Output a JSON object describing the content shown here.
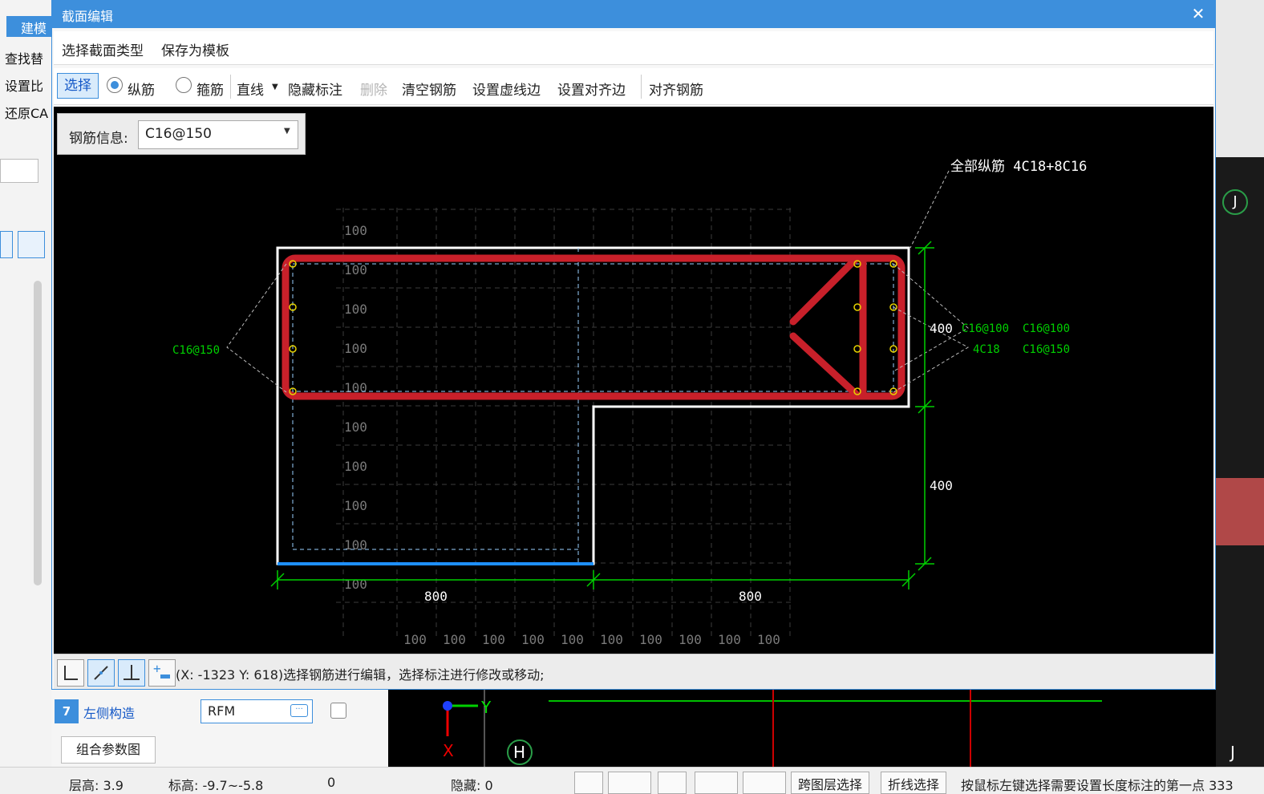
{
  "background_app": {
    "module_tab": "建模",
    "side_items": [
      "查找替",
      "设置比",
      "还原CA"
    ],
    "property_row": {
      "number": "7",
      "label": "左侧构造",
      "value": "RFM"
    },
    "combo_button": "组合参数图",
    "status": {
      "floor_height": "层高: 3.9",
      "elevation": "标高: -9.7~-5.8",
      "count": "0",
      "hidden": "隐藏: 0",
      "cross_layer_select": "跨图层选择",
      "polyline_select": "折线选择",
      "hint": "按鼠标左键选择需要设置长度标注的第一点 333"
    },
    "axis_labels": [
      "H",
      "J",
      "J",
      "Y",
      "X"
    ]
  },
  "dialog": {
    "title": "截面编辑",
    "close_label": "✕",
    "menu": [
      "选择截面类型",
      "保存为模板"
    ],
    "toolbar": {
      "select": "选择",
      "longitudinal": "纵筋",
      "stirrup": "箍筋",
      "line": "直线",
      "hide_dimension": "隐藏标注",
      "delete": "删除",
      "clear_rebar": "清空钢筋",
      "set_dashed_edge": "设置虚线边",
      "set_align_edge": "设置对齐边",
      "align_rebar": "对齐钢筋"
    },
    "rebar_info": {
      "label": "钢筋信息:",
      "value": "C16@150"
    },
    "drawing": {
      "all_longitudinal": "全部纵筋  4C18+8C16",
      "left_stirrup": "C16@150",
      "right_labels": [
        "400",
        "C16@100",
        "C16@100",
        "4C18",
        "C16@150"
      ],
      "dim_vertical": [
        "400",
        "400"
      ],
      "dim_horizontal": [
        "800",
        "800"
      ],
      "grid_label": "100",
      "colors": {
        "rebar": "#c8202a",
        "outline": "#ffffff",
        "dimension": "#00d000",
        "grid": "#3a3a3a",
        "selected_edge": "#1e90ff"
      }
    },
    "status_message": "(X: -1323 Y: 618)选择钢筋进行编辑，选择标注进行修改或移动;"
  }
}
